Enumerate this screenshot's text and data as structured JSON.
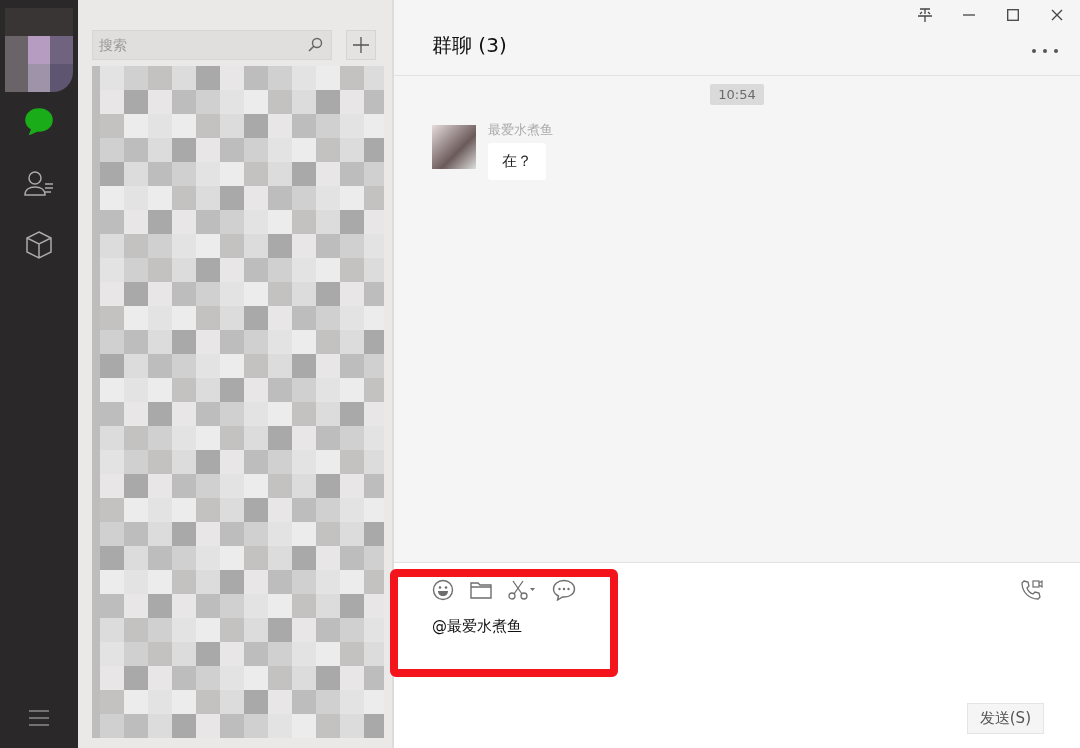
{
  "nav": [
    {
      "kind": "chat",
      "selected": true
    },
    {
      "kind": "contacts",
      "selected": false
    },
    {
      "kind": "favorites",
      "selected": false
    }
  ],
  "search": {
    "placeholder": "搜索"
  },
  "chat": {
    "title": "群聊 (3)",
    "time": "10:54",
    "messages": [
      {
        "sender": "最爱水煮鱼",
        "text": "在？"
      }
    ],
    "input": {
      "value": "@最爱水煮鱼"
    },
    "send_button": "发送(S)",
    "highlighted": true
  }
}
